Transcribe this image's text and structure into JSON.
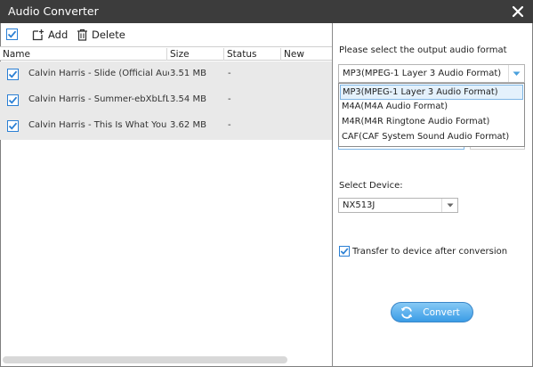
{
  "window": {
    "title": "Audio Converter"
  },
  "toolbar": {
    "add_label": "Add",
    "delete_label": "Delete"
  },
  "table": {
    "columns": [
      "Name",
      "Size",
      "Status",
      "New Name"
    ],
    "rows": [
      {
        "name": "Calvin Harris - Slide (Official Audio) ft....",
        "size": "3.51 MB",
        "status": "-",
        "new_name": "",
        "checked": true
      },
      {
        "name": "Calvin Harris - Summer-ebXbLfLACG...",
        "size": "3.54 MB",
        "status": "-",
        "new_name": "",
        "checked": true
      },
      {
        "name": "Calvin Harris - This Is What You Came ...",
        "size": "3.62 MB",
        "status": "-",
        "new_name": "",
        "checked": true
      }
    ]
  },
  "right": {
    "format_prompt": "Please select the output audio format",
    "format_selected": "MP3(MPEG-1 Layer 3 Audio Format)",
    "format_options": [
      "MP3(MPEG-1 Layer 3 Audio Format)",
      "M4A(M4A Audio Format)",
      "M4R(M4R Ringtone Audio Format)",
      "CAF(CAF System Sound Audio Format)"
    ],
    "device_label": "Select Device:",
    "device_selected": "NX513J",
    "transfer_label": "Transfer to device after conversion",
    "transfer_checked": true,
    "convert_label": "Convert"
  },
  "colors": {
    "titlebar": "#3c3c3c",
    "checkbox_accent": "#2a7fd4",
    "dropdown_highlight": "#e4f1fc",
    "button": "#3a9ce6"
  },
  "icons": [
    "close-icon",
    "checkbox-icon",
    "add-file-icon",
    "trash-icon",
    "chevron-down-icon",
    "refresh-icon"
  ]
}
